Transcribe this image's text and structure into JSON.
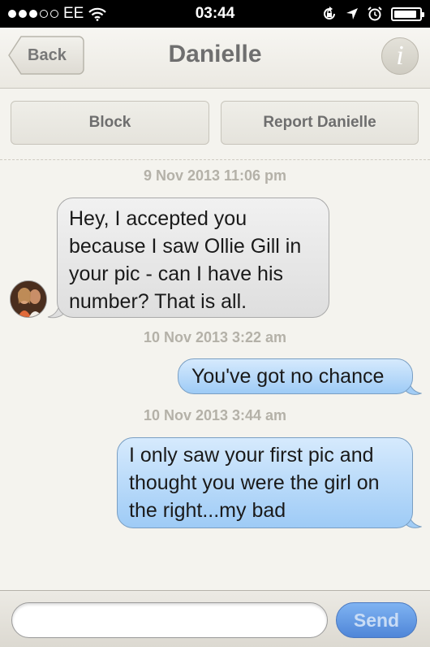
{
  "status_bar": {
    "carrier": "EE",
    "time": "03:44",
    "signal_bars_filled": 3,
    "signal_bars_total": 5,
    "battery_level": 0.9
  },
  "nav": {
    "back_label": "Back",
    "title": "Danielle",
    "info_label": "i"
  },
  "actions": {
    "block_label": "Block",
    "report_label": "Report Danielle"
  },
  "messages": [
    {
      "timestamp": "9 Nov 2013 11:06 pm",
      "direction": "received",
      "lines": [
        "Hey, I accepted you",
        "because I saw Ollie Gill in",
        "your pic - can I have his",
        "number? That is all."
      ]
    },
    {
      "timestamp": "10 Nov 2013 3:22 am",
      "direction": "sent",
      "lines": [
        "You've got no chance"
      ]
    },
    {
      "timestamp": "10 Nov 2013 3:44 am",
      "direction": "sent",
      "lines": [
        "I only saw your first pic and",
        "thought you were the girl on",
        "the right...my bad"
      ]
    }
  ],
  "composer": {
    "input_value": "",
    "input_placeholder": "",
    "send_label": "Send"
  },
  "colors": {
    "sent_bubble": "#a9d1f7",
    "received_bubble": "#e6e6e6",
    "background": "#f4f3ee",
    "send_button": "#5d92de"
  },
  "icons": [
    "wifi-icon",
    "rotation-lock-icon",
    "location-arrow-icon",
    "alarm-clock-icon",
    "battery-icon",
    "back-arrow-icon",
    "info-icon"
  ]
}
